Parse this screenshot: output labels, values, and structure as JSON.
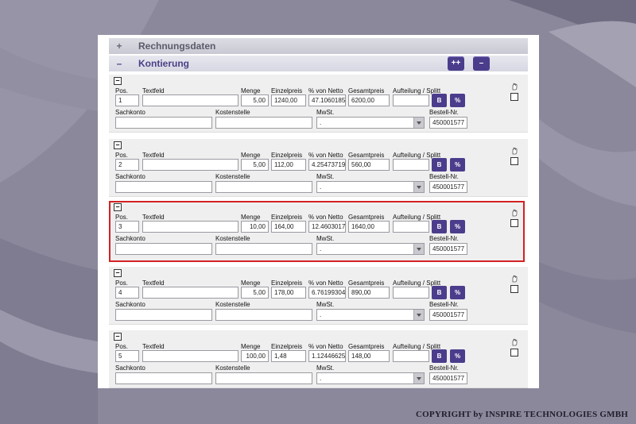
{
  "sections": {
    "invoice_data": {
      "sign": "+",
      "title": "Rechnungsdaten"
    },
    "coding": {
      "sign": "–",
      "title": "Kontierung",
      "add_all_label": "++",
      "remove_label": "–"
    }
  },
  "labels": {
    "pos": "Pos.",
    "textfeld": "Textfeld",
    "menge": "Menge",
    "einzelpreis": "Einzelpreis",
    "von_netto": "% von Netto",
    "gesamtpreis": "Gesamtpreis",
    "aufteilung": "Aufteilung / Splitt",
    "sachkonto": "Sachkonto",
    "kostenstelle": "Kostenstelle",
    "mwst": "MwSt.",
    "bestell_nr": "Bestell-Nr.",
    "b_button": "B",
    "pct_button": "%",
    "collapse_sign": "–"
  },
  "rows": [
    {
      "pos": "1",
      "textfeld": "",
      "menge": "5,00",
      "einzelpreis": "1240,00",
      "von_netto": "47.1060185",
      "gesamtpreis": "6200,00",
      "aufteilung": "",
      "sachkonto": "",
      "kostenstelle": "",
      "mwst": ".",
      "bestell_nr": "450001577",
      "highlighted": false
    },
    {
      "pos": "2",
      "textfeld": "",
      "menge": "5,00",
      "einzelpreis": "112,00",
      "von_netto": "4.25473719",
      "gesamtpreis": "560,00",
      "aufteilung": "",
      "sachkonto": "",
      "kostenstelle": "",
      "mwst": ".",
      "bestell_nr": "450001577",
      "highlighted": false
    },
    {
      "pos": "3",
      "textfeld": "",
      "menge": "10,00",
      "einzelpreis": "164,00",
      "von_netto": "12.4603017",
      "gesamtpreis": "1640,00",
      "aufteilung": "",
      "sachkonto": "",
      "kostenstelle": "",
      "mwst": ".",
      "bestell_nr": "450001577",
      "highlighted": true
    },
    {
      "pos": "4",
      "textfeld": "",
      "menge": "5,00",
      "einzelpreis": "178,00",
      "von_netto": "6.76199304",
      "gesamtpreis": "890,00",
      "aufteilung": "",
      "sachkonto": "",
      "kostenstelle": "",
      "mwst": ".",
      "bestell_nr": "450001577",
      "highlighted": false
    },
    {
      "pos": "5",
      "textfeld": "",
      "menge": "100,00",
      "einzelpreis": "1,48",
      "von_netto": "1.12446625",
      "gesamtpreis": "148,00",
      "aufteilung": "",
      "sachkonto": "",
      "kostenstelle": "",
      "mwst": ".",
      "bestell_nr": "450001577",
      "highlighted": false
    }
  ],
  "footer": {
    "copyright": "COPYRIGHT by INSPIRE TECHNOLOGIES GMBH"
  },
  "colors": {
    "accent": "#4b3d8c",
    "highlight_border": "#d42124",
    "background": "#8a879b"
  }
}
